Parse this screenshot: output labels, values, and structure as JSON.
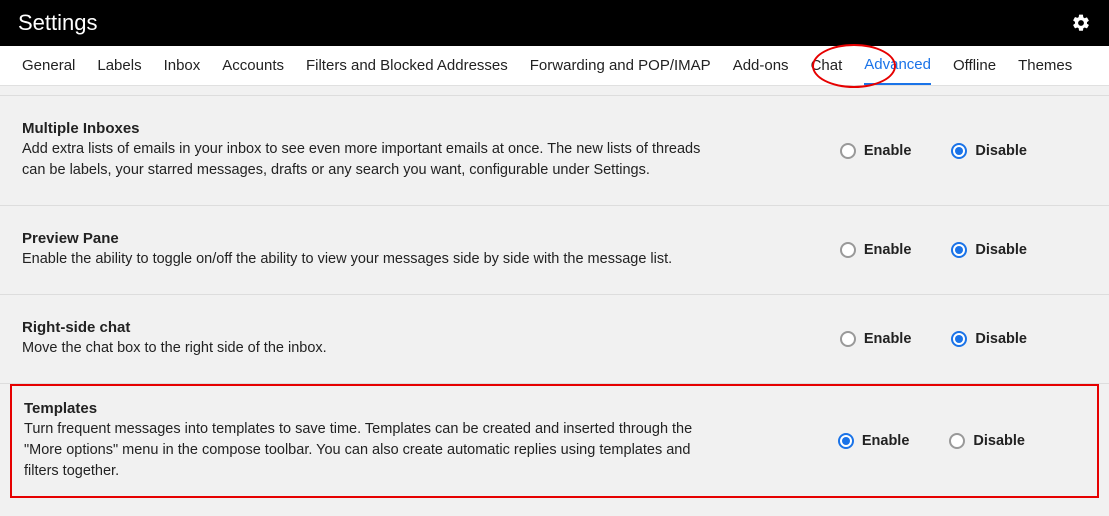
{
  "header": {
    "title": "Settings"
  },
  "tabs": {
    "items": [
      "General",
      "Labels",
      "Inbox",
      "Accounts",
      "Filters and Blocked Addresses",
      "Forwarding and POP/IMAP",
      "Add-ons",
      "Chat",
      "Advanced",
      "Offline",
      "Themes"
    ],
    "active": "Advanced"
  },
  "labels": {
    "enable": "Enable",
    "disable": "Disable"
  },
  "sections": [
    {
      "title": "Multiple Inboxes",
      "desc": "Add extra lists of emails in your inbox to see even more important emails at once. The new lists of threads can be labels, your starred messages, drafts or any search you want, configurable under Settings.",
      "value": "disable"
    },
    {
      "title": "Preview Pane",
      "desc": "Enable the ability to toggle on/off the ability to view your messages side by side with the message list.",
      "value": "disable"
    },
    {
      "title": "Right-side chat",
      "desc": "Move the chat box to the right side of the inbox.",
      "value": "disable"
    },
    {
      "title": "Templates",
      "desc": "Turn frequent messages into templates to save time. Templates can be created and inserted through the \"More options\" menu in the compose toolbar. You can also create automatic replies using templates and filters together.",
      "value": "enable",
      "highlighted": true
    }
  ]
}
